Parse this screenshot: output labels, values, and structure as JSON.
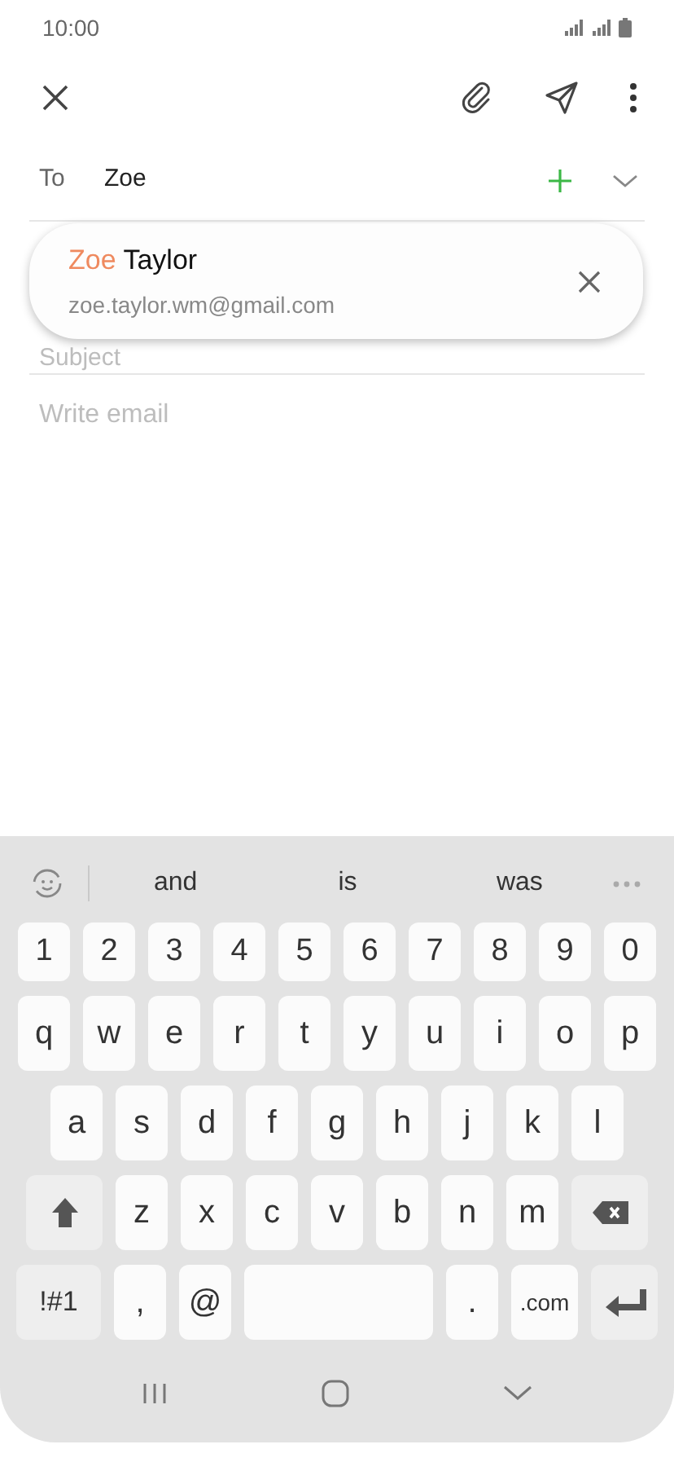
{
  "status_bar": {
    "time": "10:00"
  },
  "toolbar": {
    "actions": [
      {
        "kind": "attach"
      },
      {
        "kind": "send"
      },
      {
        "kind": "more"
      }
    ]
  },
  "to_field": {
    "label": "To",
    "value": "Zoe"
  },
  "suggestion": {
    "name_matched": "Zoe",
    "name_rest": "Taylor",
    "email": "zoe.taylor.wm@gmail.com"
  },
  "subject": {
    "placeholder": "Subject"
  },
  "body": {
    "placeholder": "Write email"
  },
  "keyboard": {
    "suggestions": [
      "and",
      "is",
      "was"
    ],
    "rows": [
      {
        "keys": [
          {
            "kind": "char",
            "label": "1"
          },
          {
            "kind": "char",
            "label": "2"
          },
          {
            "kind": "char",
            "label": "3"
          },
          {
            "kind": "char",
            "label": "4"
          },
          {
            "kind": "char",
            "label": "5"
          },
          {
            "kind": "char",
            "label": "6"
          },
          {
            "kind": "char",
            "label": "7"
          },
          {
            "kind": "char",
            "label": "8"
          },
          {
            "kind": "char",
            "label": "9"
          },
          {
            "kind": "char",
            "label": "0"
          }
        ]
      },
      {
        "keys": [
          {
            "kind": "char",
            "label": "q"
          },
          {
            "kind": "char",
            "label": "w"
          },
          {
            "kind": "char",
            "label": "e"
          },
          {
            "kind": "char",
            "label": "r"
          },
          {
            "kind": "char",
            "label": "t"
          },
          {
            "kind": "char",
            "label": "y"
          },
          {
            "kind": "char",
            "label": "u"
          },
          {
            "kind": "char",
            "label": "i"
          },
          {
            "kind": "char",
            "label": "o"
          },
          {
            "kind": "char",
            "label": "p"
          }
        ]
      },
      {
        "keys": [
          {
            "kind": "char",
            "label": "a"
          },
          {
            "kind": "char",
            "label": "s"
          },
          {
            "kind": "char",
            "label": "d"
          },
          {
            "kind": "char",
            "label": "f"
          },
          {
            "kind": "char",
            "label": "g"
          },
          {
            "kind": "char",
            "label": "h"
          },
          {
            "kind": "char",
            "label": "j"
          },
          {
            "kind": "char",
            "label": "k"
          },
          {
            "kind": "char",
            "label": "l"
          }
        ]
      },
      {
        "keys": [
          {
            "kind": "shift"
          },
          {
            "kind": "char",
            "label": "z"
          },
          {
            "kind": "char",
            "label": "x"
          },
          {
            "kind": "char",
            "label": "c"
          },
          {
            "kind": "char",
            "label": "v"
          },
          {
            "kind": "char",
            "label": "b"
          },
          {
            "kind": "char",
            "label": "n"
          },
          {
            "kind": "char",
            "label": "m"
          },
          {
            "kind": "backspace"
          }
        ]
      },
      {
        "keys": [
          {
            "kind": "symbols",
            "label": "!#1"
          },
          {
            "kind": "char",
            "label": ","
          },
          {
            "kind": "char",
            "label": "@"
          },
          {
            "kind": "space"
          },
          {
            "kind": "char",
            "label": "."
          },
          {
            "kind": "domain",
            "label": ".com"
          },
          {
            "kind": "enter"
          }
        ]
      }
    ]
  }
}
